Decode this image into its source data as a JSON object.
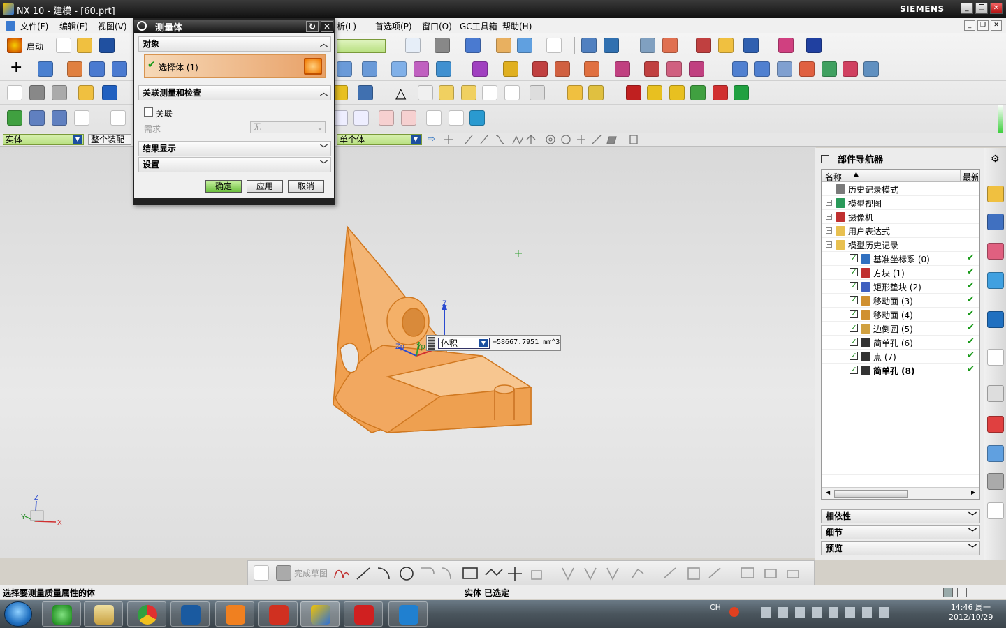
{
  "window": {
    "title": "NX 10 - 建模 - [60.prt]",
    "brand": "SIEMENS"
  },
  "menu": {
    "items": [
      "文件(F)",
      "编辑(E)",
      "视图(V)"
    ],
    "items_right": [
      "析(L)",
      "首选项(P)",
      "窗口(O)",
      "GC工具箱",
      "帮助(H)"
    ]
  },
  "toolbar": {
    "start_label": "启动"
  },
  "selection_bar": {
    "filter": "实体",
    "scope": "整个装配",
    "body_filter": "单个体"
  },
  "dialog": {
    "title": "测量体",
    "sections": {
      "object": "对象",
      "assoc": "关联测量和检查",
      "result": "结果显示",
      "settings": "设置"
    },
    "select_body_label": "选择体 (1)",
    "assoc_checkbox": "关联",
    "require_label": "需求",
    "require_value": "无",
    "buttons": {
      "ok": "确定",
      "apply": "应用",
      "cancel": "取消"
    }
  },
  "measure_popup": {
    "type": "体积",
    "value": "=58667.7951 mm^3"
  },
  "viewport": {
    "axes": [
      "Z",
      "Zp",
      "Yp"
    ],
    "triad": [
      "Z",
      "Y",
      "X"
    ]
  },
  "navigator": {
    "title": "部件导航器",
    "col_name": "名称",
    "col_latest": "最新",
    "items": [
      {
        "label": "历史记录模式",
        "level": 0,
        "expander": false,
        "check": false,
        "ok": false,
        "icon": "clock-icon",
        "color": "#7a7a7a"
      },
      {
        "label": "模型视图",
        "level": 0,
        "expander": true,
        "check": false,
        "ok": false,
        "icon": "model-views-icon",
        "color": "#2a9a5a"
      },
      {
        "label": "摄像机",
        "level": 0,
        "expander": true,
        "check": false,
        "ok": false,
        "icon": "camera-icon",
        "color": "#c03030"
      },
      {
        "label": "用户表达式",
        "level": 0,
        "expander": true,
        "check": false,
        "ok": false,
        "icon": "folder-icon",
        "color": "#e8c050"
      },
      {
        "label": "模型历史记录",
        "level": 0,
        "expander": true,
        "check": false,
        "ok": false,
        "icon": "folder-open-icon",
        "color": "#e8c050"
      },
      {
        "label": "基准坐标系 (0)",
        "level": 1,
        "expander": false,
        "check": true,
        "ok": true,
        "icon": "datum-csys-icon",
        "color": "#3070c0"
      },
      {
        "label": "方块 (1)",
        "level": 1,
        "expander": false,
        "check": true,
        "ok": true,
        "icon": "block-icon",
        "color": "#c03030"
      },
      {
        "label": "矩形垫块 (2)",
        "level": 1,
        "expander": false,
        "check": true,
        "ok": true,
        "icon": "pad-icon",
        "color": "#4060c0"
      },
      {
        "label": "移动面 (3)",
        "level": 1,
        "expander": false,
        "check": true,
        "ok": true,
        "icon": "move-face-icon",
        "color": "#d09030"
      },
      {
        "label": "移动面 (4)",
        "level": 1,
        "expander": false,
        "check": true,
        "ok": true,
        "icon": "move-face-icon",
        "color": "#d09030"
      },
      {
        "label": "边倒圆 (5)",
        "level": 1,
        "expander": false,
        "check": true,
        "ok": true,
        "icon": "edge-blend-icon",
        "color": "#d0a040"
      },
      {
        "label": "简单孔 (6)",
        "level": 1,
        "expander": false,
        "check": true,
        "ok": true,
        "icon": "hole-icon",
        "color": "#333333"
      },
      {
        "label": "点 (7)",
        "level": 1,
        "expander": false,
        "check": true,
        "ok": true,
        "icon": "point-icon",
        "color": "#333333"
      },
      {
        "label": "简单孔 (8)",
        "level": 1,
        "expander": false,
        "check": true,
        "ok": true,
        "icon": "hole-icon",
        "color": "#333333",
        "bold": true
      }
    ],
    "panels": [
      "相依性",
      "细节",
      "预览"
    ]
  },
  "sketch_toolbar": {
    "finish_label": "完成草图"
  },
  "status": {
    "message": "选择要测量质量属性的体",
    "selection": "实体 已选定"
  },
  "taskbar": {
    "ime": "CH",
    "time": "14:46 周一",
    "date": "2012/10/29"
  },
  "colors": {
    "part_orange": "#f0a050",
    "accent_green": "#1a9a1a",
    "selection_bar_green": "#b8e080"
  }
}
